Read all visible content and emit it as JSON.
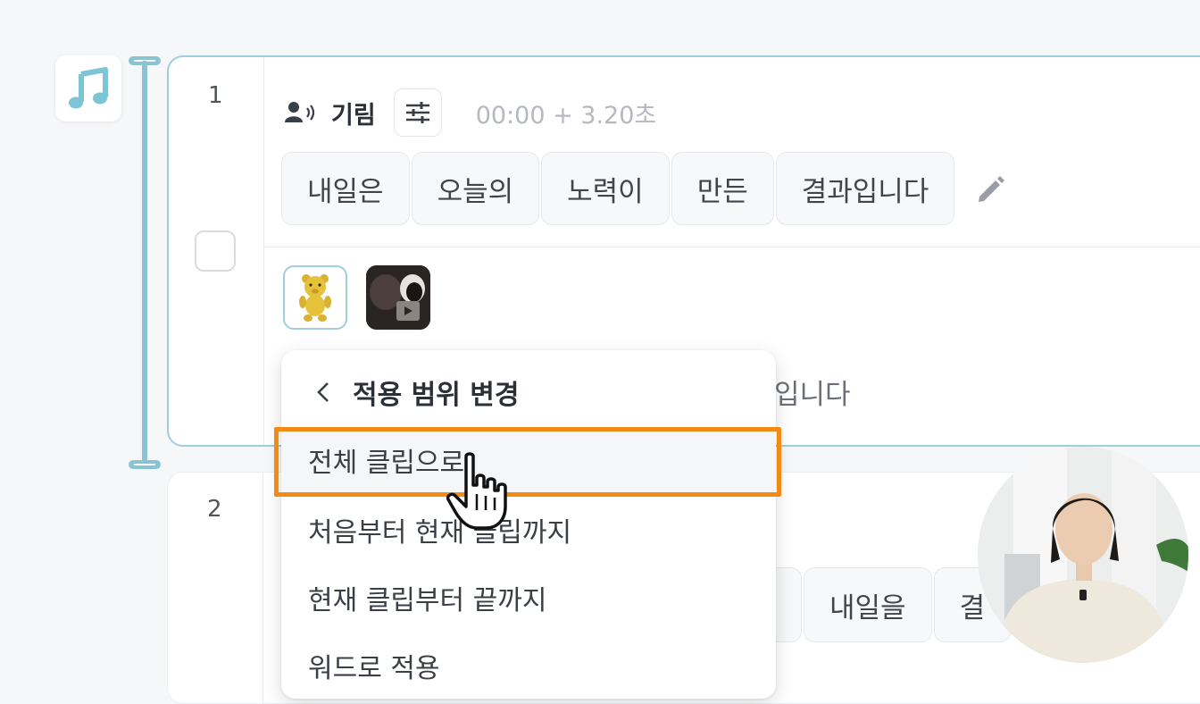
{
  "colors": {
    "accent": "#9fcfdb",
    "highlight": "#f28a16",
    "music_icon": "#7cc5d6"
  },
  "icons": {
    "music": "music-note-icon",
    "speaker": "speaker-voice-icon",
    "settings": "sliders-icon",
    "edit": "pencil-icon",
    "back": "chevron-left-icon",
    "cursor": "hand-pointer-icon"
  },
  "clip1": {
    "number": "1",
    "speaker": "기림",
    "timecode": "00:00 + 3.20초",
    "words": [
      "내일은",
      "오늘의",
      "노력이",
      "만든",
      "결과입니다"
    ],
    "caption_tail": "입니다"
  },
  "clip2": {
    "number": "2",
    "words": [
      "",
      "내일을",
      "결"
    ]
  },
  "menu": {
    "title": "적용 범위 변경",
    "items": [
      "전체 클립으로",
      "처음부터 현재 클립까지",
      "현재 클립부터 끝까지",
      "워드로 적용"
    ]
  }
}
